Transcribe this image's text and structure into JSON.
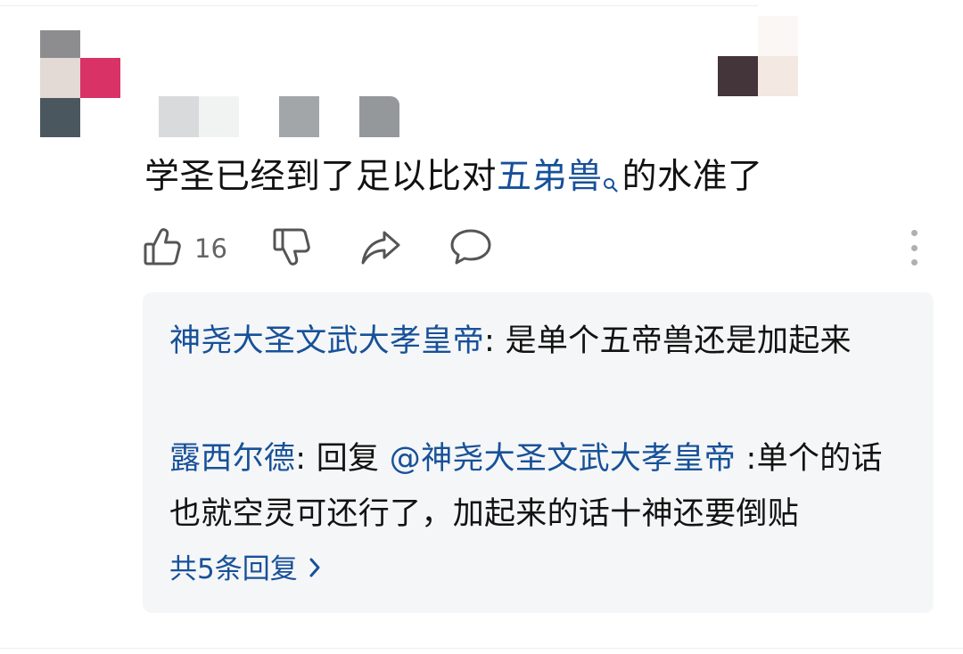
{
  "comment": {
    "text_before": "学圣已经到了足以比对",
    "link_word": "五弟兽",
    "text_after": "的水准了",
    "like_count": "16"
  },
  "icons": {
    "like": "thumbs-up-icon",
    "dislike": "thumbs-down-icon",
    "share": "share-arrow-icon",
    "reply": "speech-bubble-icon",
    "more": "more-vertical-icon",
    "search": "search-icon",
    "chevron": "chevron-right-icon"
  },
  "replies": [
    {
      "author": "神尧大圣文武大孝皇帝",
      "separator": ": ",
      "text": "是单个五帝兽还是加起来"
    },
    {
      "author": "露西尔德",
      "separator": ": ",
      "reply_prefix": "回复 ",
      "mention": "@神尧大圣文武大孝皇帝",
      "text": " :单个的话也就空灵可还行了，加起来的话十神还要倒贴"
    }
  ],
  "view_all_label": "共5条回复",
  "colors": {
    "link": "#175199",
    "text": "#121212",
    "muted": "#646464",
    "reply_bg": "#f5f6f7"
  }
}
